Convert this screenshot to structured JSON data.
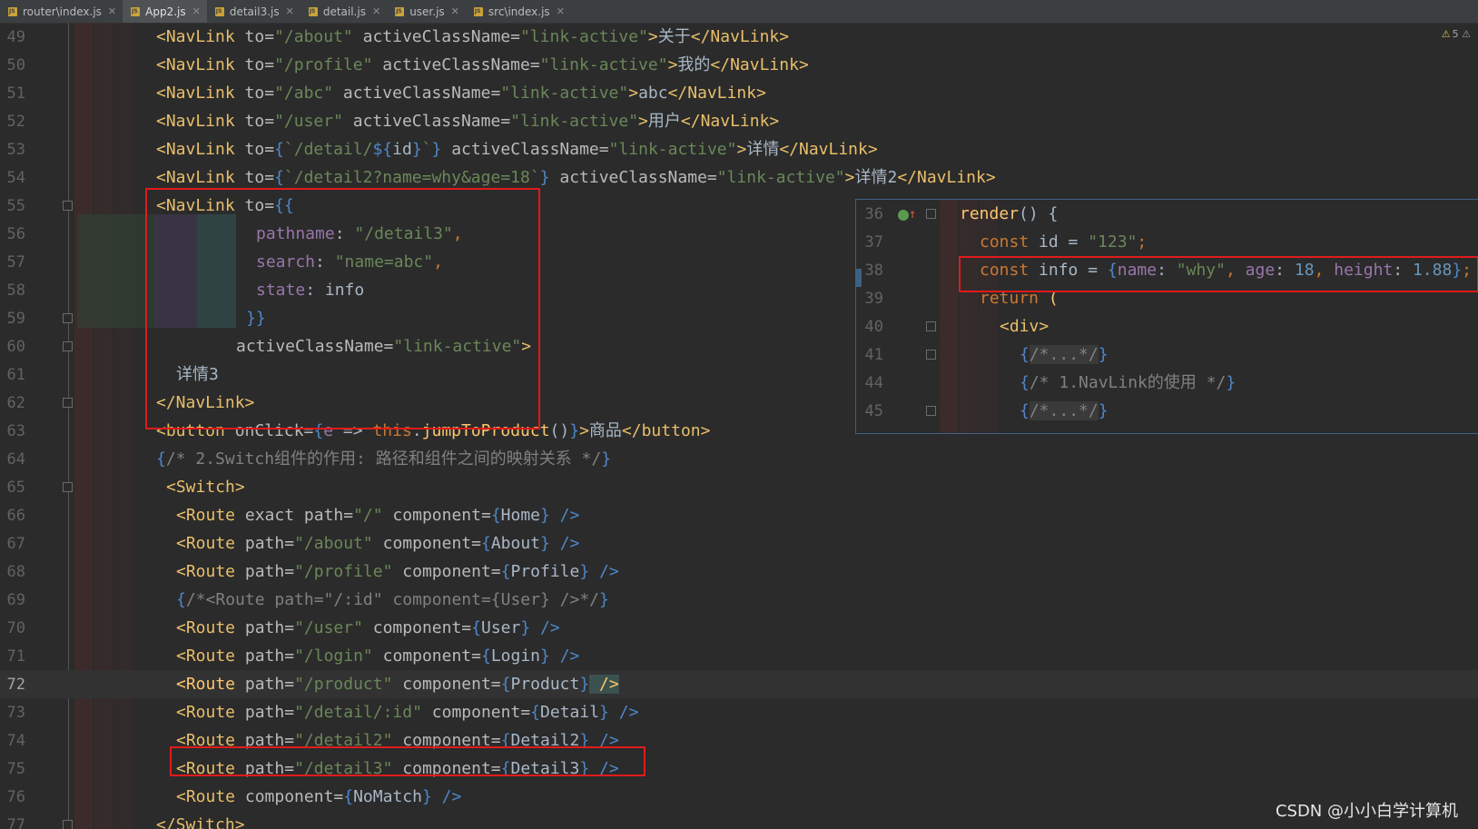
{
  "tabs": [
    {
      "label": "router\\index.js",
      "active": false
    },
    {
      "label": "App2.js",
      "active": true
    },
    {
      "label": "detail3.js",
      "active": false
    },
    {
      "label": "detail.js",
      "active": false
    },
    {
      "label": "user.js",
      "active": false
    },
    {
      "label": "src\\index.js",
      "active": false
    }
  ],
  "inspection": {
    "icon": "warning-icon",
    "count": "5"
  },
  "line_numbers": [
    "49",
    "50",
    "51",
    "52",
    "53",
    "54",
    "55",
    "56",
    "57",
    "58",
    "59",
    "60",
    "61",
    "62",
    "63",
    "64",
    "65",
    "66",
    "67",
    "68",
    "69",
    "70",
    "71",
    "72",
    "73",
    "74",
    "75",
    "76",
    "77"
  ],
  "code": {
    "l49": {
      "t1": "<NavLink",
      "a1": " to=",
      "s1": "\"/about\"",
      "a2": " activeClassName=",
      "s2": "\"link-active\"",
      "t2": ">",
      "text": "关于",
      "t3": "</NavLink>"
    },
    "l50": {
      "t1": "<NavLink",
      "a1": " to=",
      "s1": "\"/profile\"",
      "a2": " activeClassName=",
      "s2": "\"link-active\"",
      "t2": ">",
      "text": "我的",
      "t3": "</NavLink>"
    },
    "l51": {
      "t1": "<NavLink",
      "a1": " to=",
      "s1": "\"/abc\"",
      "a2": " activeClassName=",
      "s2": "\"link-active\"",
      "t2": ">",
      "text": "abc",
      "t3": "</NavLink>"
    },
    "l52": {
      "t1": "<NavLink",
      "a1": " to=",
      "s1": "\"/user\"",
      "a2": " activeClassName=",
      "s2": "\"link-active\"",
      "t2": ">",
      "text": "用户",
      "t3": "</NavLink>"
    },
    "l53": {
      "t1": "<NavLink",
      "a1": " to=",
      "b1": "{",
      "s1": "`/detail/",
      "b2": "${",
      "v": "id",
      "b3": "}",
      "s2": "`",
      "b4": "}",
      "a2": " activeClassName=",
      "s3": "\"link-active\"",
      "t2": ">",
      "text": "详情",
      "t3": "</NavLink>"
    },
    "l54": {
      "t1": "<NavLink",
      "a1": " to=",
      "b1": "{",
      "s1": "`/detail2?name=why&age=18`",
      "b2": "}",
      "a2": " activeClassName=",
      "s2": "\"link-active\"",
      "t2": ">",
      "text": "详情2",
      "t3": "</NavLink>"
    },
    "l55": {
      "t1": "<NavLink",
      "a1": " to=",
      "b1": "{{"
    },
    "l56": {
      "p": "pathname",
      "c": ": ",
      "s": "\"/detail3\"",
      "e": ","
    },
    "l57": {
      "p": "search",
      "c": ": ",
      "s": "\"name=abc\"",
      "e": ","
    },
    "l58": {
      "p": "state",
      "c": ": ",
      "v": "info"
    },
    "l59": {
      "b": "}}"
    },
    "l60": {
      "a": "activeClassName=",
      "s": "\"link-active\"",
      "t": ">"
    },
    "l61": {
      "text": "详情3"
    },
    "l62": {
      "t": "</NavLink>"
    },
    "l63": {
      "t1": "<button",
      "a1": " onClick=",
      "b1": "{",
      "p": "e",
      "op": " => ",
      "k": "this",
      "d": ".",
      "f": "jumpToProduct",
      "pr": "()",
      "b2": "}",
      "t2": ">",
      "text": "商品",
      "t3": "</button>"
    },
    "l64": {
      "b1": "{",
      "c": "/* 2.Switch组件的作用: 路径和组件之间的映射关系 */",
      "b2": "}"
    },
    "l65": {
      "t": "<Switch>"
    },
    "l66": {
      "t1": "<Route",
      "a1": " exact path=",
      "s1": "\"/\"",
      "a2": " component=",
      "b1": "{",
      "v": "Home",
      "b2": "}",
      "t2": " />"
    },
    "l67": {
      "t1": "<Route",
      "a1": " path=",
      "s1": "\"/about\"",
      "a2": " component=",
      "b1": "{",
      "v": "About",
      "b2": "}",
      "t2": " />"
    },
    "l68": {
      "t1": "<Route",
      "a1": " path=",
      "s1": "\"/profile\"",
      "a2": " component=",
      "b1": "{",
      "v": "Profile",
      "b2": "}",
      "t2": " />"
    },
    "l69": {
      "b1": "{",
      "c": "/*<Route path=\"/:id\" component={User} />*/",
      "b2": "}"
    },
    "l70": {
      "t1": "<Route",
      "a1": " path=",
      "s1": "\"/user\"",
      "a2": " component=",
      "b1": "{",
      "v": "User",
      "b2": "}",
      "t2": " />"
    },
    "l71": {
      "t1": "<Route",
      "a1": " path=",
      "s1": "\"/login\"",
      "a2": " component=",
      "b1": "{",
      "v": "Login",
      "b2": "}",
      "t2": " />"
    },
    "l72": {
      "t1": "<Route",
      "a1": " path=",
      "s1": "\"/product\"",
      "a2": " component=",
      "b1": "{",
      "v": "Product",
      "b2": "}",
      "t2": " />"
    },
    "l73": {
      "t1": "<Route",
      "a1": " path=",
      "s1": "\"/detail/:id\"",
      "a2": " component=",
      "b1": "{",
      "v": "Detail",
      "b2": "}",
      "t2": " />"
    },
    "l74": {
      "t1": "<Route",
      "a1": " path=",
      "s1": "\"/detail2\"",
      "a2": " component=",
      "b1": "{",
      "v": "Detail2",
      "b2": "}",
      "t2": " />"
    },
    "l75": {
      "t1": "<Route",
      "a1": " path=",
      "s1": "\"/detail3\"",
      "a2": " component=",
      "b1": "{",
      "v": "Detail3",
      "b2": "}",
      "t2": " />"
    },
    "l76": {
      "t1": "<Route",
      "a1": " component=",
      "b1": "{",
      "v": "NoMatch",
      "b2": "}",
      "t2": " />"
    },
    "l77": {
      "t": "</Switch>"
    }
  },
  "popup": {
    "line_numbers": [
      "36",
      "37",
      "38",
      "39",
      "40",
      "41",
      "44",
      "45"
    ],
    "l36": {
      "f": "render",
      "p": "() ",
      "b": "{"
    },
    "l37": {
      "k": "const ",
      "v": "id = ",
      "s": "\"123\"",
      "e": ";"
    },
    "l38": {
      "k": "const ",
      "v": "info = ",
      "b1": "{",
      "p1": "name",
      "c1": ": ",
      "s": "\"why\"",
      "c2": ", ",
      "p2": "age",
      "c3": ": ",
      "n1": "18",
      "c4": ", ",
      "p3": "height",
      "c5": ": ",
      "n2": "1.88",
      "b2": "}",
      "e": ";"
    },
    "l39": {
      "k": "return ",
      "p": "("
    },
    "l40": {
      "t": "<div>"
    },
    "l41": {
      "b1": "{",
      "c": "/*...*/",
      "b2": "}"
    },
    "l44": {
      "b1": "{",
      "c": "/* 1.NavLink的使用 */",
      "b2": "}"
    },
    "l45": {
      "b1": "{",
      "c": "/*...*/",
      "b2": "}"
    }
  },
  "watermark": "CSDN @小小白学计算机"
}
